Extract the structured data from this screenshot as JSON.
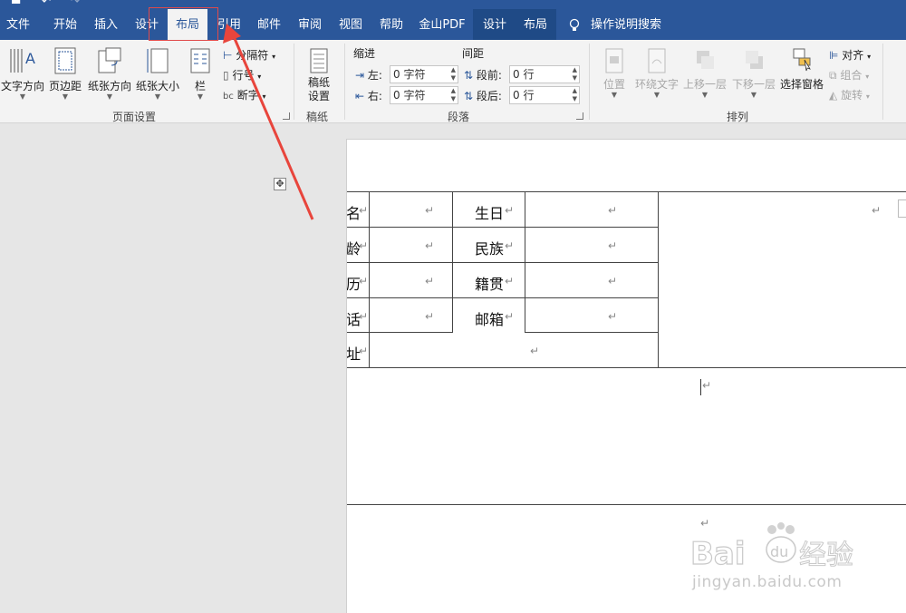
{
  "tabs": [
    {
      "label": "文件"
    },
    {
      "label": "开始"
    },
    {
      "label": "插入"
    },
    {
      "label": "设计"
    },
    {
      "label": "布局"
    },
    {
      "label": "引用"
    },
    {
      "label": "邮件"
    },
    {
      "label": "审阅"
    },
    {
      "label": "视图"
    },
    {
      "label": "帮助"
    },
    {
      "label": "金山PDF"
    },
    {
      "label": "设计"
    },
    {
      "label": "布局"
    }
  ],
  "tell_me": "操作说明搜索",
  "ribbon": {
    "page_setup": {
      "text_direction": "文字方向",
      "margins": "页边距",
      "orientation": "纸张方向",
      "size": "纸张大小",
      "columns": "栏",
      "breaks": "分隔符",
      "line_numbers": "行号",
      "hyphenation": "断字",
      "group_label": "页面设置"
    },
    "draft": {
      "button": "稿纸\n设置",
      "btn_l1": "稿纸",
      "btn_l2": "设置",
      "group_label": "稿纸"
    },
    "paragraph": {
      "indent_title": "缩进",
      "spacing_title": "间距",
      "left_label": "左:",
      "right_label": "右:",
      "before_label": "段前:",
      "after_label": "段后:",
      "left_value": "0 字符",
      "right_value": "0 字符",
      "before_value": "0 行",
      "after_value": "0 行",
      "group_label": "段落"
    },
    "arrange": {
      "position": "位置",
      "wrap": "环绕文字",
      "forward": "上移一层",
      "backward": "下移一层",
      "selection_pane": "选择窗格",
      "align": "对齐",
      "group": "组合",
      "rotate": "旋转",
      "group_label": "排列"
    }
  },
  "table": {
    "left_col": [
      "名",
      "龄",
      "历",
      "话",
      "址"
    ],
    "mid_labels": [
      "生日",
      "民族",
      "籍贯",
      "邮箱"
    ],
    "mark": "↵"
  },
  "watermark": {
    "text": "jingyan.baidu.com"
  },
  "colors": {
    "ribbon_blue": "#2b579a",
    "highlight": "#e04a4a",
    "arrow": "#e8453c"
  }
}
